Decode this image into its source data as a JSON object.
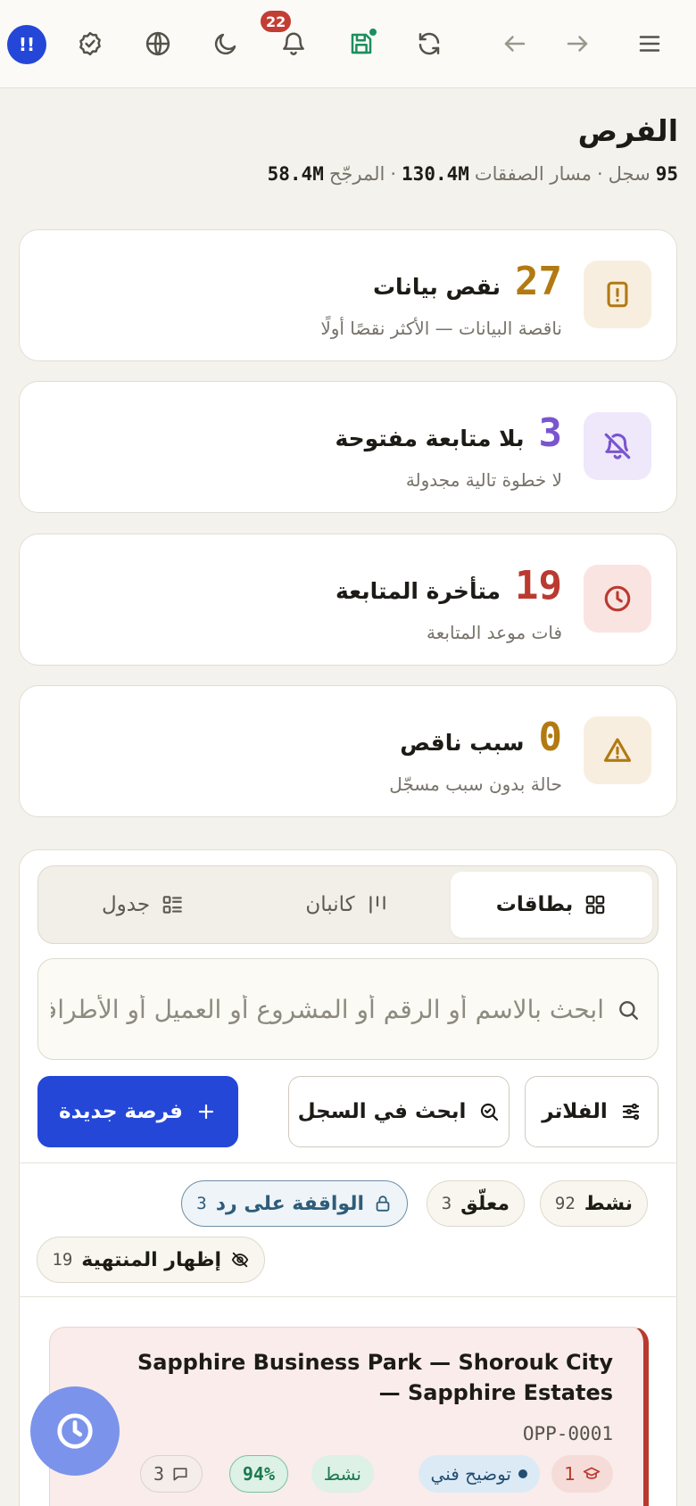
{
  "topbar": {
    "avatar_initial": "!!",
    "notifications_count": "22"
  },
  "header": {
    "title": "الفرص",
    "records_count": "95",
    "records_label": "سجل",
    "sep": "·",
    "pipeline_label": "مسار الصفقات",
    "pipeline_value": "130.4M",
    "weighted_label": "المرجّح",
    "weighted_value": "58.4M"
  },
  "stats": [
    {
      "value": "27",
      "label": "نقص بيانات",
      "desc": "ناقصة البيانات — الأكثر نقصًا أولًا",
      "color": "#b27a12",
      "icon_bg": "#f8eedf",
      "icon": "alert-file-icon"
    },
    {
      "value": "3",
      "label": "بلا متابعة مفتوحة",
      "desc": "لا خطوة تالية مجدولة",
      "color": "#7a55cf",
      "icon_bg": "#eee8fa",
      "icon": "bell-off-icon"
    },
    {
      "value": "19",
      "label": "متأخرة المتابعة",
      "desc": "فات موعد المتابعة",
      "color": "#bb3a30",
      "icon_bg": "#f9e4e1",
      "icon": "clock-icon"
    },
    {
      "value": "0",
      "label": "سبب ناقص",
      "desc": "حالة بدون سبب مسجّل",
      "color": "#b27a12",
      "icon_bg": "#f8eedf",
      "icon": "warning-icon"
    }
  ],
  "views": {
    "cards": "بطاقات",
    "kanban": "كانبان",
    "table": "جدول"
  },
  "search": {
    "placeholder": "ابحث بالاسم أو الرقم أو المشروع أو العميل أو الأطراف"
  },
  "actions": {
    "filters": "الفلاتر",
    "search_log": "ابحث في السجل",
    "new_opportunity": "فرصة جديدة"
  },
  "chips": {
    "active_label": "نشط",
    "active_count": "92",
    "pending_label": "معلّق",
    "pending_count": "3",
    "awaiting_label": "الواقفة على رد",
    "awaiting_count": "3",
    "show_closed_label": "إظهار المنتهية",
    "show_closed_count": "19"
  },
  "opportunity": {
    "title": "Sapphire Business Park — Shorouk City — Sapphire Estates",
    "code": "OPP-0001",
    "badge_count": "1",
    "stage": "توضيح فني",
    "status": "نشط",
    "score": "94%",
    "comments": "3"
  }
}
